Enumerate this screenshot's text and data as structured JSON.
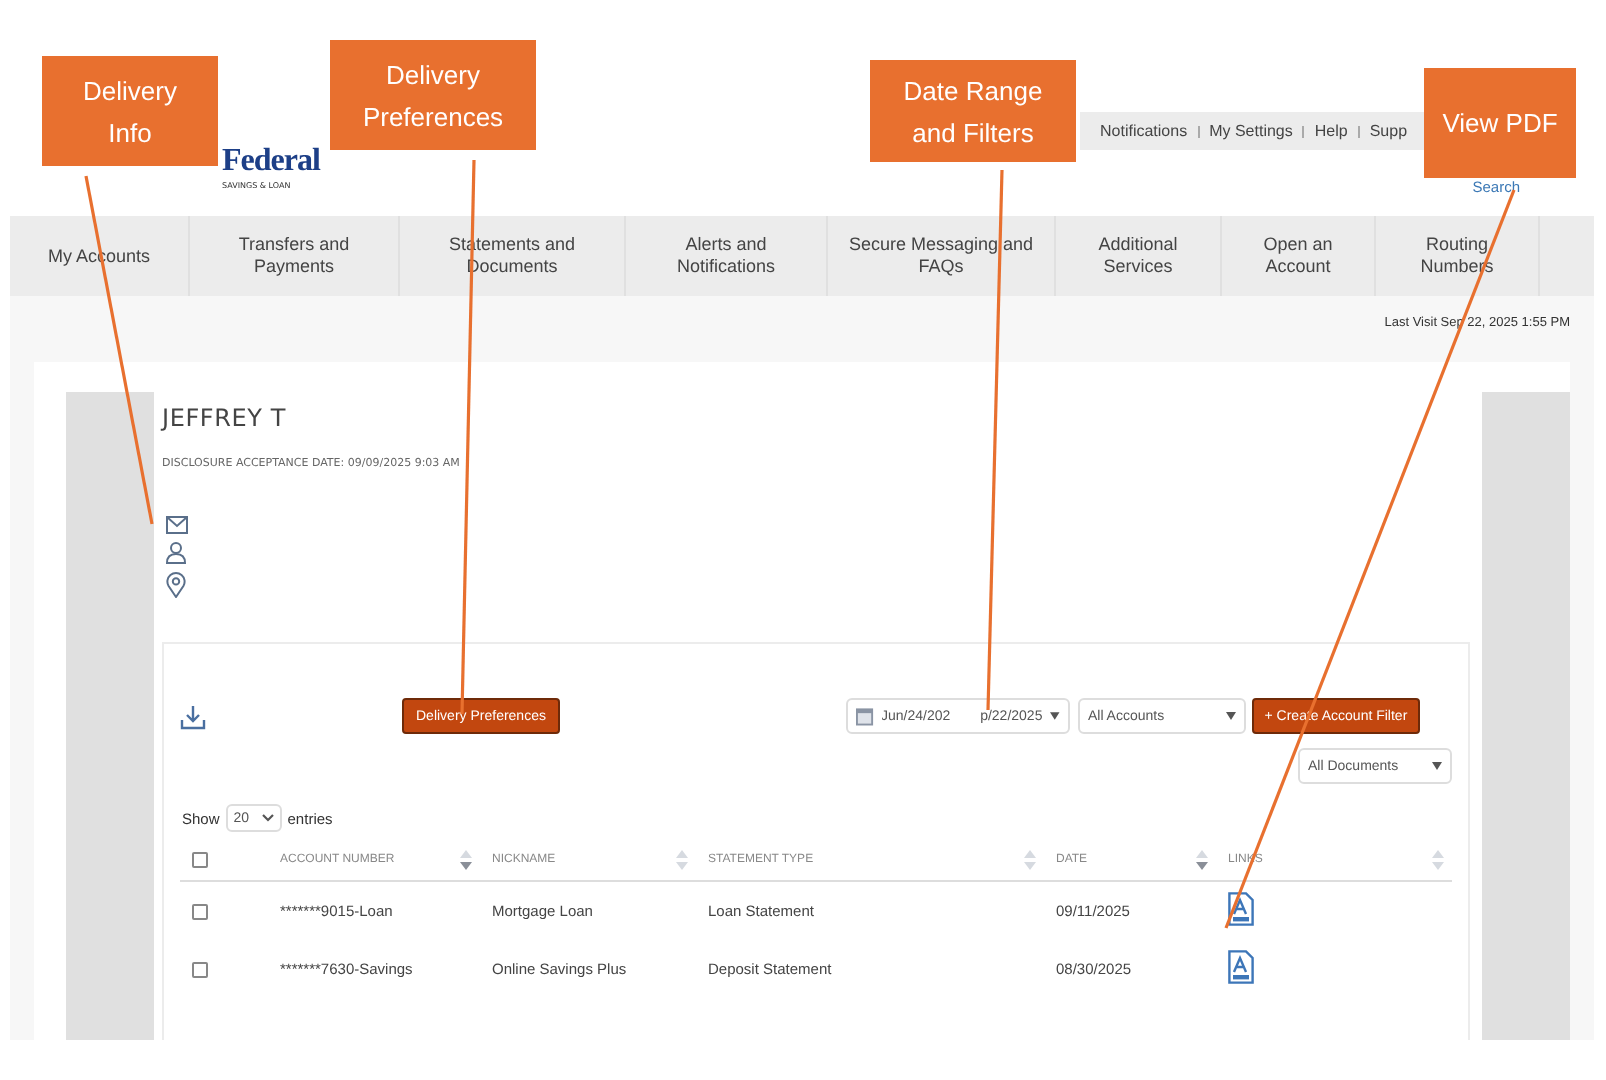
{
  "logo": {
    "name": "Federal",
    "tagline": "SAVINGS & LOAN"
  },
  "top_links": [
    "Notifications",
    "My Settings",
    "Help",
    "Supp"
  ],
  "search_link": "Search",
  "nav": [
    {
      "label": "My Accounts"
    },
    {
      "label": "Transfers and Payments"
    },
    {
      "label": "Statements and Documents"
    },
    {
      "label": "Alerts and Notifications"
    },
    {
      "label": "Secure Messaging and FAQs"
    },
    {
      "label": "Additional Services"
    },
    {
      "label": "Open an Account"
    },
    {
      "label": "Routing Numbers"
    }
  ],
  "last_visit": "Last Visit Sep 22, 2025 1:55 PM",
  "profile": {
    "name": "JEFFREY T",
    "disclosure": "DISCLOSURE ACCEPTANCE DATE: 09/09/2025 9:03 AM"
  },
  "toolbar": {
    "delivery_button": "Delivery Preferences",
    "date_from": "Jun/24/202",
    "date_to": "p/22/2025",
    "accounts_select": "All Accounts",
    "create_button": "+ Create Account Filter",
    "documents_select": "All Documents"
  },
  "show": {
    "before": "Show",
    "value": "20",
    "after": "entries"
  },
  "table": {
    "all_checked": false,
    "columns": [
      {
        "label": "ACCOUNT NUMBER",
        "sorted": true
      },
      {
        "label": "NICKNAME",
        "sorted": false
      },
      {
        "label": "STATEMENT TYPE",
        "sorted": false
      },
      {
        "label": "DATE",
        "sorted": true
      },
      {
        "label": "LINKS",
        "sorted": false
      }
    ],
    "rows": [
      {
        "checked": false,
        "account": "*******9015-Loan",
        "nickname": "Mortgage Loan",
        "type": "Loan Statement",
        "date": "09/11/2025"
      },
      {
        "checked": false,
        "account": "*******7630-Savings",
        "nickname": "Online Savings Plus",
        "type": "Deposit Statement",
        "date": "08/30/2025"
      }
    ]
  },
  "annotations": [
    {
      "label": "Delivery Info"
    },
    {
      "label": "Delivery Preferences"
    },
    {
      "label": "Date Range and Filters"
    },
    {
      "label": "View PDF"
    }
  ]
}
